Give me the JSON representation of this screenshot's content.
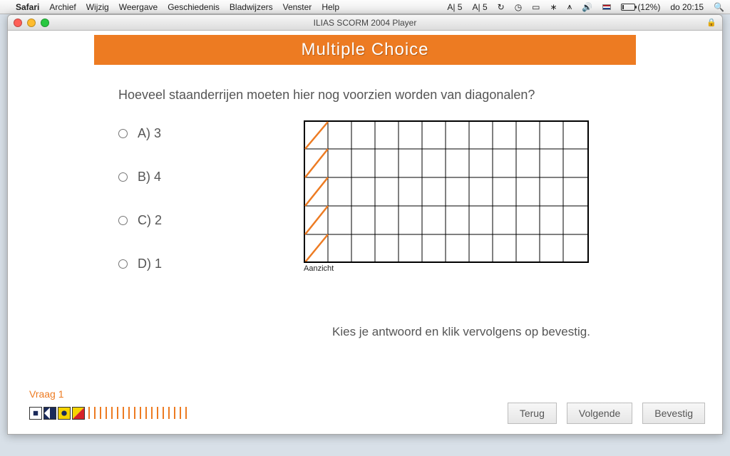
{
  "menubar": {
    "app": "Safari",
    "items": [
      "Archief",
      "Wijzig",
      "Weergave",
      "Geschiedenis",
      "Bladwijzers",
      "Venster",
      "Help"
    ],
    "status_left_icons": [
      "A| 5",
      "A| 5"
    ],
    "battery_pct": "(12%)",
    "clock": "do 20:15"
  },
  "window": {
    "title": "ILIAS SCORM 2004 Player"
  },
  "page": {
    "header": "Multiple Choice",
    "question": "Hoeveel staanderrijen moeten hier nog voorzien worden van diagonalen?",
    "options": [
      {
        "label": "A) 3"
      },
      {
        "label": "B) 4"
      },
      {
        "label": "C) 2"
      },
      {
        "label": "D) 1"
      }
    ],
    "figure_caption": "Aanzicht",
    "hint": "Kies je antwoord en klik vervolgens op bevestig.",
    "progress_label": "Vraag 1",
    "remaining_ticks": 18
  },
  "buttons": {
    "back": "Terug",
    "next": "Volgende",
    "confirm": "Bevestig"
  }
}
